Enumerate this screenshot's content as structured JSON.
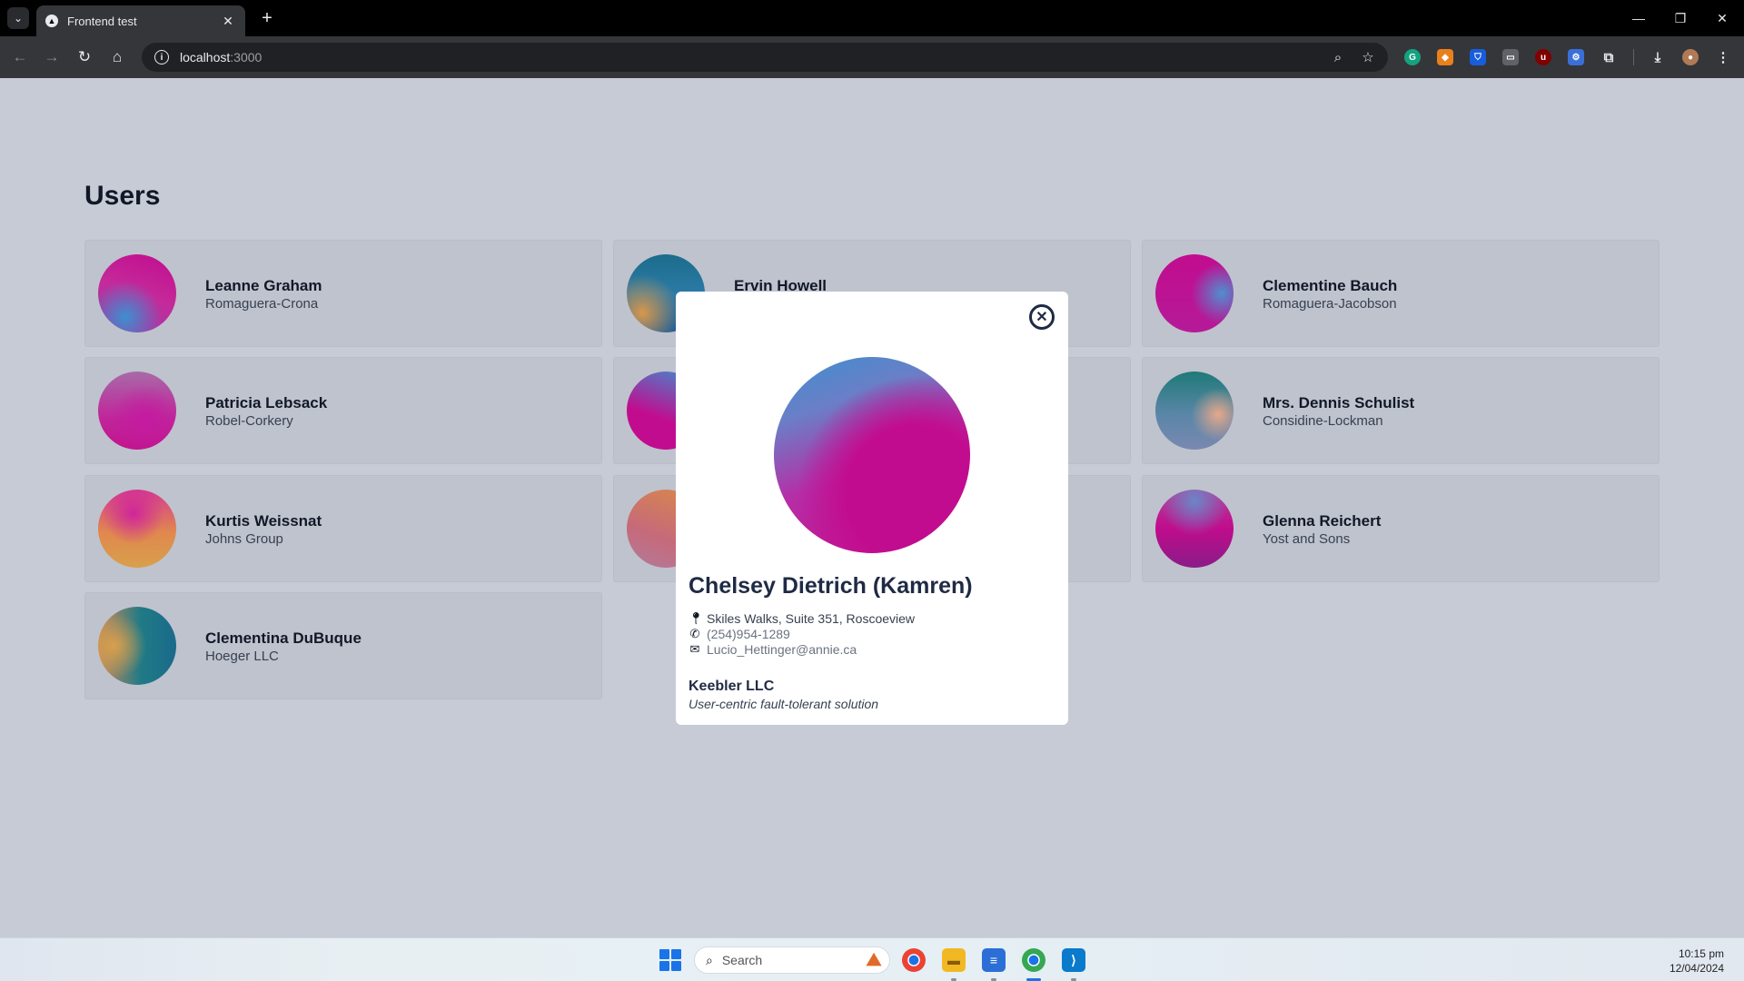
{
  "browser": {
    "tab_title": "Frontend test",
    "url_host": "localhost",
    "url_port": ":3000"
  },
  "page": {
    "title": "Users"
  },
  "users": [
    {
      "name": "Leanne Graham",
      "company": "Romaguera-Crona"
    },
    {
      "name": "Ervin Howell",
      "company": ""
    },
    {
      "name": "Clementine Bauch",
      "company": "Romaguera-Jacobson"
    },
    {
      "name": "Patricia Lebsack",
      "company": "Robel-Corkery"
    },
    {
      "name": "",
      "company": ""
    },
    {
      "name": "Mrs. Dennis Schulist",
      "company": "Considine-Lockman"
    },
    {
      "name": "Kurtis Weissnat",
      "company": "Johns Group"
    },
    {
      "name": "",
      "company": ""
    },
    {
      "name": "Glenna Reichert",
      "company": "Yost and Sons"
    },
    {
      "name": "Clementina DuBuque",
      "company": "Hoeger LLC"
    }
  ],
  "modal": {
    "full_name": "Chelsey Dietrich (Kamren)",
    "address": "Skiles Walks, Suite 351, Roscoeview",
    "phone": "(254)954-1289",
    "email": "Lucio_Hettinger@annie.ca",
    "company_name": "Keebler LLC",
    "catch_phrase": "User-centric fault-tolerant solution",
    "close_label": "✕"
  },
  "taskbar": {
    "search_placeholder": "Search",
    "time": "10:15 pm",
    "date": "12/04/2024"
  }
}
